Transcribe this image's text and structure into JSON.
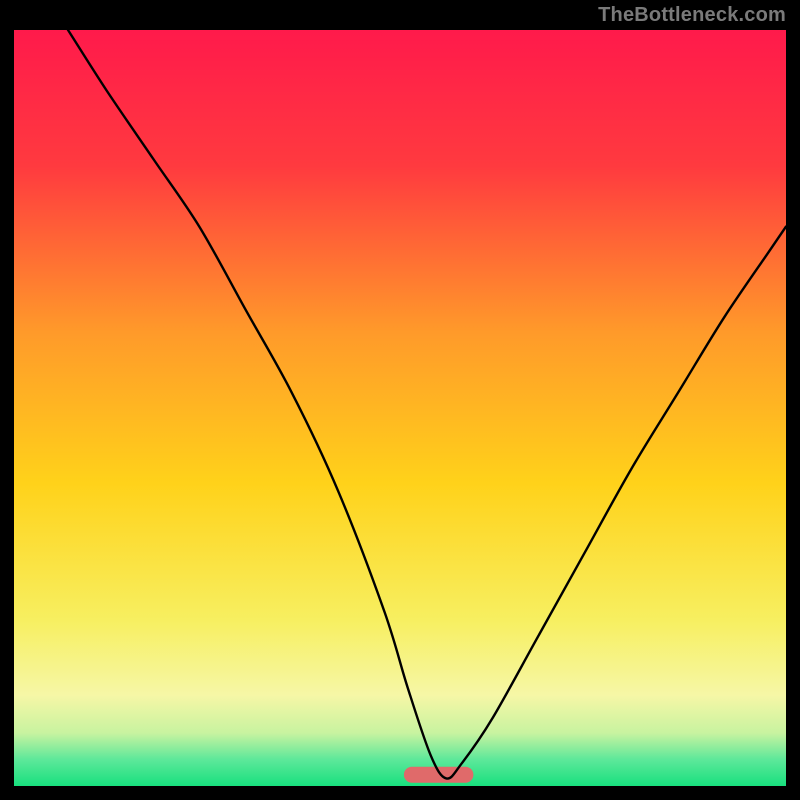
{
  "watermark": "TheBottleneck.com",
  "chart_data": {
    "type": "line",
    "title": "",
    "xlabel": "",
    "ylabel": "",
    "xlim": [
      0,
      100
    ],
    "ylim": [
      0,
      100
    ],
    "background_gradient": {
      "stops": [
        {
          "offset": 0.0,
          "color": "#ff1a4b"
        },
        {
          "offset": 0.18,
          "color": "#ff3a3f"
        },
        {
          "offset": 0.4,
          "color": "#ff9a2a"
        },
        {
          "offset": 0.6,
          "color": "#ffd21a"
        },
        {
          "offset": 0.78,
          "color": "#f7ef60"
        },
        {
          "offset": 0.88,
          "color": "#f6f7a6"
        },
        {
          "offset": 0.93,
          "color": "#c8f3a0"
        },
        {
          "offset": 0.965,
          "color": "#5de89a"
        },
        {
          "offset": 1.0,
          "color": "#18e07e"
        }
      ]
    },
    "optimal_band": {
      "x_center": 55,
      "x_width": 9,
      "y": 1.5,
      "color": "#e06a6a"
    },
    "series": [
      {
        "name": "bottleneck-curve",
        "color": "#000000",
        "stroke_width": 2.4,
        "x": [
          7,
          12,
          18,
          24,
          30,
          36,
          42,
          48,
          51,
          54,
          56,
          58,
          62,
          68,
          74,
          80,
          86,
          92,
          98,
          100
        ],
        "y": [
          100,
          92,
          83,
          74,
          63,
          52,
          39,
          23,
          13,
          4,
          1,
          3,
          9,
          20,
          31,
          42,
          52,
          62,
          71,
          74
        ]
      }
    ]
  }
}
